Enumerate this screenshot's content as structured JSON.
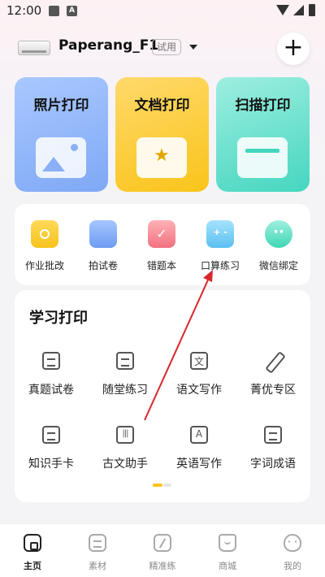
{
  "status_bar": {
    "time": "12:00"
  },
  "header": {
    "device_name": "Paperang_F1",
    "trial_badge": "试用"
  },
  "print_cards": [
    {
      "title": "照片打印",
      "color": "#8db3fa"
    },
    {
      "title": "文档打印",
      "color": "#fbce3a"
    },
    {
      "title": "扫描打印",
      "color": "#5edcc8"
    }
  ],
  "tools": [
    {
      "label": "作业批改",
      "icon": "camera-icon"
    },
    {
      "label": "拍试卷",
      "icon": "folder-icon"
    },
    {
      "label": "错题本",
      "icon": "notebook-icon"
    },
    {
      "label": "口算练习",
      "icon": "calculator-icon"
    },
    {
      "label": "微信绑定",
      "icon": "wechat-icon"
    }
  ],
  "study": {
    "title": "学习打印",
    "items": [
      {
        "label": "真题试卷",
        "icon": "scroll-icon"
      },
      {
        "label": "随堂练习",
        "icon": "document-icon"
      },
      {
        "label": "语文写作",
        "icon": "chinese-char-icon"
      },
      {
        "label": "菁优专区",
        "icon": "pen-icon"
      },
      {
        "label": "知识手卡",
        "icon": "card-icon"
      },
      {
        "label": "古文助手",
        "icon": "ancient-text-icon"
      },
      {
        "label": "英语写作",
        "icon": "english-icon"
      },
      {
        "label": "字词成语",
        "icon": "dictionary-icon"
      }
    ]
  },
  "bottom_nav": [
    {
      "label": "主页",
      "active": true,
      "icon": "home-icon"
    },
    {
      "label": "素材",
      "active": false,
      "icon": "material-icon"
    },
    {
      "label": "精准练",
      "active": false,
      "icon": "practice-icon"
    },
    {
      "label": "商城",
      "active": false,
      "icon": "shop-icon"
    },
    {
      "label": "我的",
      "active": false,
      "icon": "profile-icon"
    }
  ],
  "colors": {
    "accent": "#ffc21b",
    "annotation_arrow": "#d8262c"
  }
}
